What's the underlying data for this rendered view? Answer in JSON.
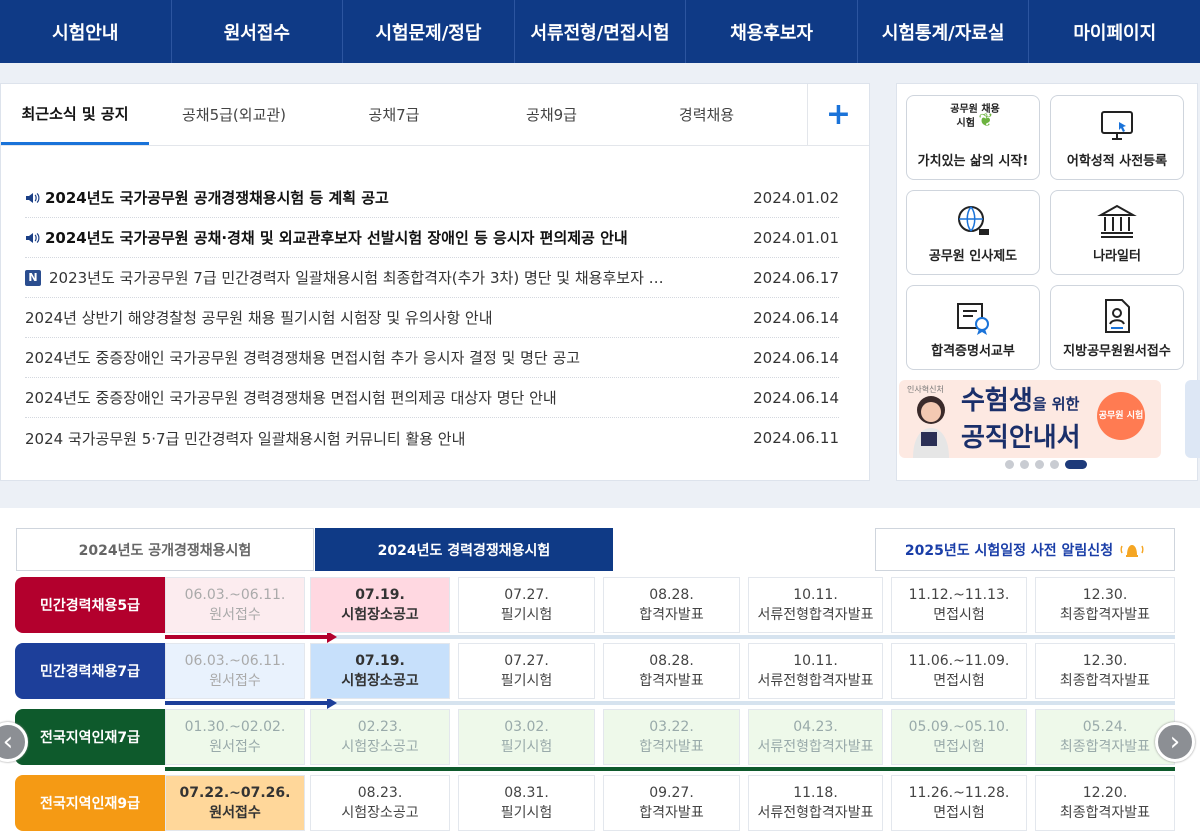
{
  "nav": [
    "시험안내",
    "원서접수",
    "시험문제/정답",
    "서류전형/면접시험",
    "채용후보자",
    "시험통계/자료실",
    "마이페이지"
  ],
  "news": {
    "tabs": [
      "최근소식 및 공지",
      "공채5급(외교관)",
      "공채7급",
      "공채9급",
      "경력채용"
    ],
    "more_label": "+",
    "items": [
      {
        "title": "2024년도 국가공무원 공개경쟁채용시험 등 계획 공고",
        "date": "2024.01.02",
        "icon": "speaker-icon"
      },
      {
        "title": "2024년도 국가공무원 공채·경채 및 외교관후보자 선발시험 장애인 등 응시자 편의제공 안내",
        "date": "2024.01.01",
        "icon": "speaker-icon"
      },
      {
        "title": "2023년도 국가공무원 7급 민간경력자 일괄채용시험 최종합격자(추가 3차) 명단 및 채용후보자 …",
        "date": "2024.06.17",
        "badge": "N"
      },
      {
        "title": "2024년 상반기 해양경찰청 공무원 채용 필기시험 시험장 및 유의사항 안내",
        "date": "2024.06.14"
      },
      {
        "title": "2024년도 중증장애인 국가공무원 경력경쟁채용 면접시험 추가 응시자 결정 및 명단 공고",
        "date": "2024.06.14"
      },
      {
        "title": "2024년도 중증장애인 국가공무원 경력경쟁채용 면접시험 편의제공 대상자 명단 안내",
        "date": "2024.06.14"
      },
      {
        "title": "2024 국가공무원 5·7급 민간경력자 일괄채용시험 커뮤니티 활용 안내",
        "date": "2024.06.11"
      }
    ]
  },
  "quick": {
    "items": [
      {
        "label": "가치있는 삶의 시작!",
        "logo_text": "공무원 채용 시험"
      },
      {
        "label": "어학성적 사전등록"
      },
      {
        "label": "공무원 인사제도"
      },
      {
        "label": "나라일터"
      },
      {
        "label": "합격증명서교부"
      },
      {
        "label": "지방공무원원서접수"
      }
    ],
    "banner": {
      "brand": "인사혁신처",
      "line1_big": "수험생",
      "line1_small": "을 위한",
      "line2": "공직안내서",
      "seal": "공무원 시험"
    }
  },
  "schedule": {
    "tabs": [
      "2024년도 공개경쟁채용시험",
      "2024년도 경력경쟁채용시험"
    ],
    "notify_label": "2025년도 시험일정 사전 알림신청",
    "rows": [
      {
        "name": "민간경력채용5급",
        "color": "#b3002d",
        "progress": 0.16,
        "cells": [
          [
            "06.03.~06.11.",
            "원서접수"
          ],
          [
            "07.19.",
            "시험장소공고"
          ],
          [
            "07.27.",
            "필기시험"
          ],
          [
            "08.28.",
            "합격자발표"
          ],
          [
            "10.11.",
            "서류전형합격자발표"
          ],
          [
            "11.12.~11.13.",
            "면접시험"
          ],
          [
            "12.30.",
            "최종합격자발표"
          ]
        ]
      },
      {
        "name": "민간경력채용7급",
        "color": "#1d3f9a",
        "progress": 0.16,
        "cells": [
          [
            "06.03.~06.11.",
            "원서접수"
          ],
          [
            "07.19.",
            "시험장소공고"
          ],
          [
            "07.27.",
            "필기시험"
          ],
          [
            "08.28.",
            "합격자발표"
          ],
          [
            "10.11.",
            "서류전형합격자발표"
          ],
          [
            "11.06.~11.09.",
            "면접시험"
          ],
          [
            "12.30.",
            "최종합격자발표"
          ]
        ]
      },
      {
        "name": "전국지역인재7급",
        "color": "#0e5a2c",
        "progress": 1.0,
        "cells": [
          [
            "01.30.~02.02.",
            "원서접수"
          ],
          [
            "02.23.",
            "시험장소공고"
          ],
          [
            "03.02.",
            "필기시험"
          ],
          [
            "03.22.",
            "합격자발표"
          ],
          [
            "04.23.",
            "서류전형합격자발표"
          ],
          [
            "05.09.~05.10.",
            "면접시험"
          ],
          [
            "05.24.",
            "최종합격자발표"
          ]
        ]
      },
      {
        "name": "전국지역인재9급",
        "color": "#f59a14",
        "progress": 0.0,
        "cells": [
          [
            "07.22.~07.26.",
            "원서접수"
          ],
          [
            "08.23.",
            "시험장소공고"
          ],
          [
            "08.31.",
            "필기시험"
          ],
          [
            "09.27.",
            "합격자발표"
          ],
          [
            "11.18.",
            "서류전형합격자발표"
          ],
          [
            "11.26.~11.28.",
            "면접시험"
          ],
          [
            "12.20.",
            "최종합격자발표"
          ]
        ]
      }
    ]
  }
}
